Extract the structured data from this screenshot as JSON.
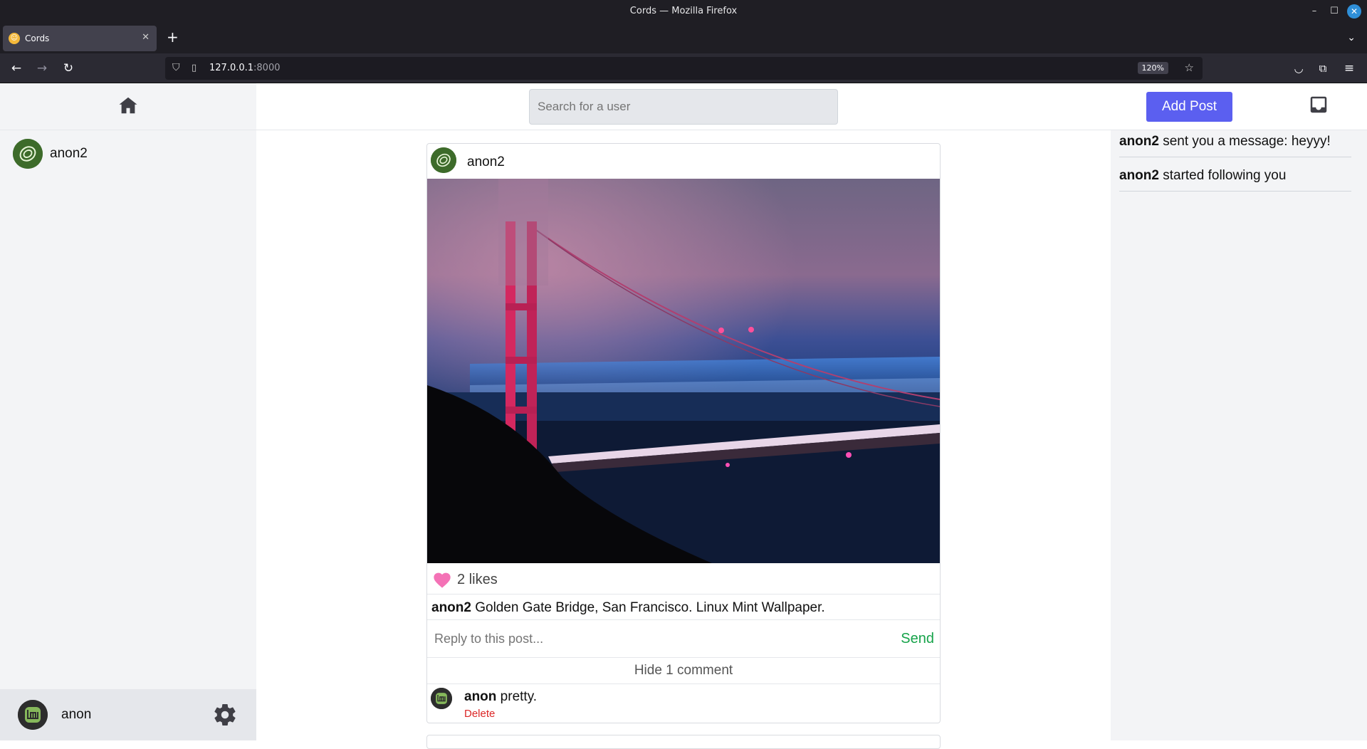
{
  "browser": {
    "window_title": "Cords — Mozilla Firefox",
    "tab_title": "Cords",
    "url_host": "127.0.0.1",
    "url_port": ":8000",
    "zoom": "120%"
  },
  "sidebar": {
    "contacts": [
      {
        "name": "anon2"
      }
    ],
    "current_user": {
      "name": "anon"
    }
  },
  "topbar": {
    "search_placeholder": "Search for a user",
    "add_post_label": "Add Post"
  },
  "notifications": [
    {
      "user": "anon2",
      "text": " sent you a message: heyyy!"
    },
    {
      "user": "anon2",
      "text": " started following you"
    }
  ],
  "post": {
    "author": "anon2",
    "likes_text": "2 likes",
    "caption_user": "anon2",
    "caption_text": " Golden Gate Bridge, San Francisco. Linux Mint Wallpaper.",
    "reply_placeholder": "Reply to this post...",
    "send_label": "Send",
    "toggle_comments_label": "Hide 1 comment",
    "comments": [
      {
        "user": "anon",
        "text": " pretty.",
        "delete_label": "Delete"
      }
    ]
  },
  "colors": {
    "accent": "#5b5ff0",
    "send": "#16a34a",
    "delete": "#dc2626",
    "heart": "#f472b6"
  }
}
